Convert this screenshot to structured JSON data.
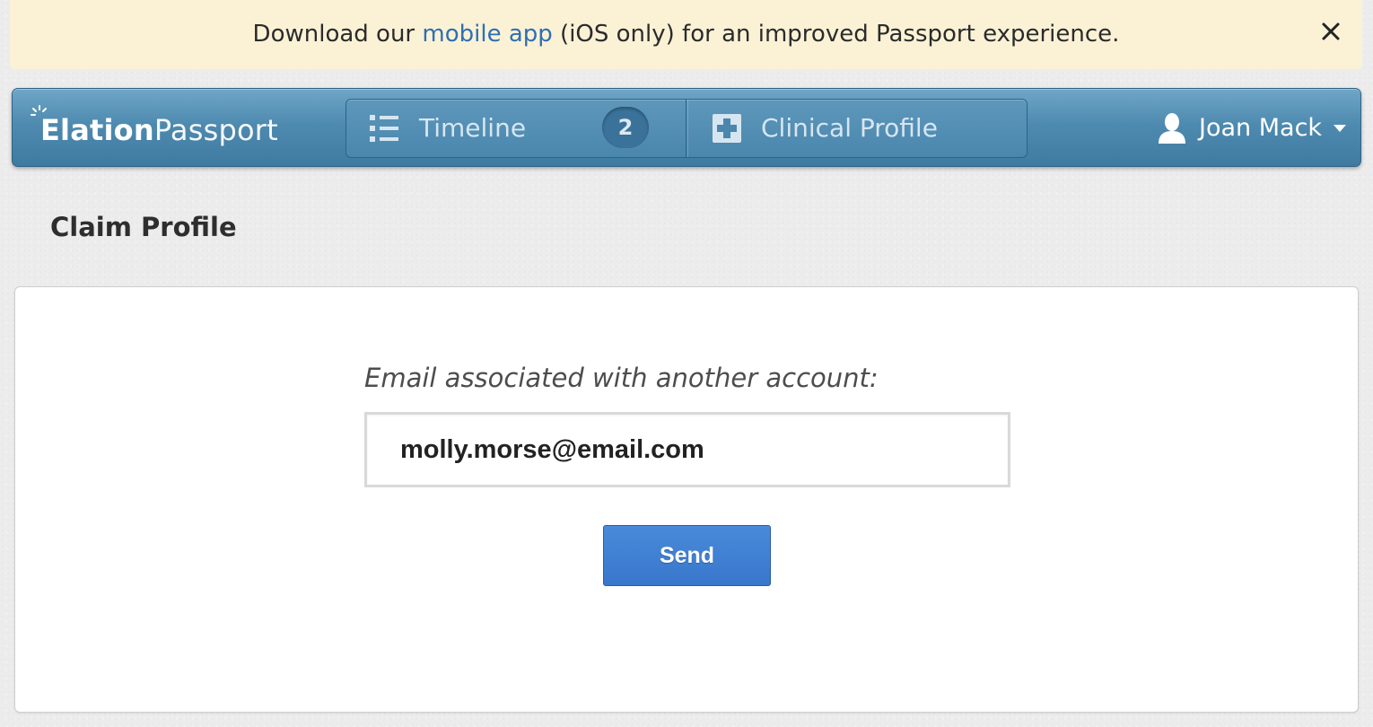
{
  "banner": {
    "text_before": "Download our ",
    "link_text": "mobile app",
    "text_after": " (iOS only) for an improved Passport experience.",
    "close_label": "×"
  },
  "brand": {
    "name_bold": "Elation",
    "name_light": "Passport"
  },
  "nav": {
    "tabs": [
      {
        "label": "Timeline",
        "icon": "list-icon",
        "badge": "2"
      },
      {
        "label": "Clinical Profile",
        "icon": "medical-cross-icon"
      }
    ],
    "user": {
      "name": "Joan Mack",
      "icon": "user-icon",
      "caret": "caret-down-icon"
    }
  },
  "page": {
    "title": "Claim Profile"
  },
  "form": {
    "email_label": "Email associated with another account:",
    "email_value": "molly.morse@email.com",
    "send_label": "Send"
  },
  "colors": {
    "navbar": "#4f8bb0",
    "banner_bg": "#fbf2d6",
    "link": "#2f6fb3",
    "primary_button": "#3d7fd1"
  }
}
